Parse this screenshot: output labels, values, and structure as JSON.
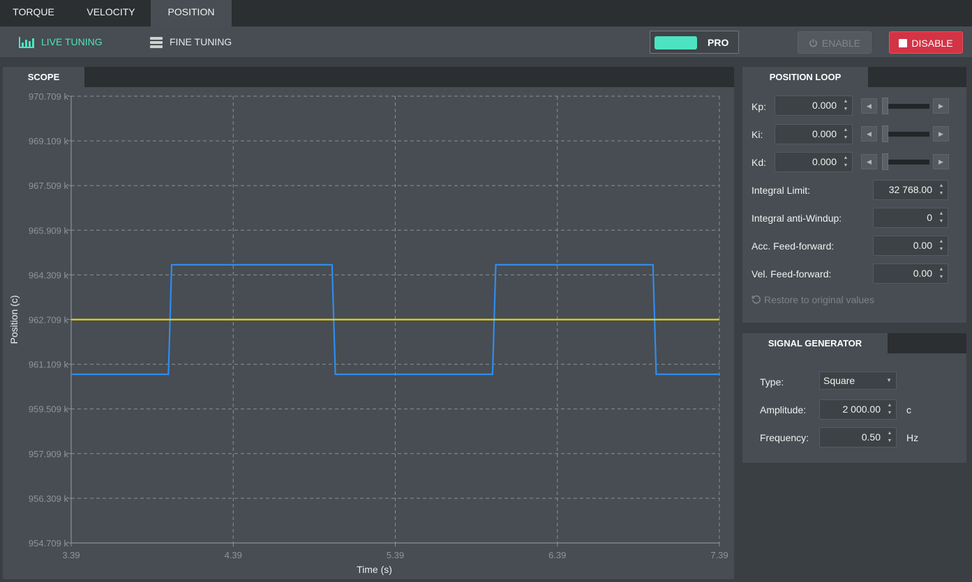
{
  "top_tabs": [
    {
      "label": "TORQUE",
      "active": false
    },
    {
      "label": "VELOCITY",
      "active": false
    },
    {
      "label": "POSITION",
      "active": true
    }
  ],
  "toolbar": {
    "live_tuning": "LIVE TUNING",
    "fine_tuning": "FINE TUNING",
    "pro_label": "PRO",
    "enable_label": "ENABLE",
    "disable_label": "DISABLE"
  },
  "scope": {
    "tab_label": "SCOPE"
  },
  "position_loop": {
    "tab_label": "POSITION LOOP",
    "gains": [
      {
        "label": "Kp:",
        "value": "0.000",
        "slider_fraction": 0
      },
      {
        "label": "Ki:",
        "value": "0.000",
        "slider_fraction": 0
      },
      {
        "label": "Kd:",
        "value": "0.000",
        "slider_fraction": 0
      }
    ],
    "params": [
      {
        "label": "Integral Limit:",
        "value": "32 768.00"
      },
      {
        "label": "Integral anti-Windup:",
        "value": "0"
      },
      {
        "label": "Acc. Feed-forward:",
        "value": "0.00"
      },
      {
        "label": "Vel. Feed-forward:",
        "value": "0.00"
      }
    ],
    "restore_label": "Restore to original values"
  },
  "signal_generator": {
    "tab_label": "SIGNAL GENERATOR",
    "type_label": "Type:",
    "type_value": "Square",
    "amplitude_label": "Amplitude:",
    "amplitude_value": "2 000.00",
    "amplitude_unit": "c",
    "frequency_label": "Frequency:",
    "frequency_value": "0.50",
    "frequency_unit": "Hz"
  },
  "colors": {
    "accent": "#4de3c2",
    "disable": "#d23445",
    "measured": "#2f8cf0",
    "reference": "#e5d31a"
  },
  "chart_data": {
    "type": "line",
    "xlabel": "Time (s)",
    "ylabel": "Position (c)",
    "x_ticks": [
      "3.39",
      "4.39",
      "5.39",
      "6.39",
      "7.39"
    ],
    "y_ticks": [
      "970.709 k",
      "969.109 k",
      "967.509 k",
      "965.909 k",
      "964.309 k",
      "962.709 k",
      "961.109 k",
      "959.509 k",
      "957.909 k",
      "956.309 k",
      "954.709 k"
    ],
    "xlim": [
      3.39,
      7.39
    ],
    "ylim": [
      954709,
      970709
    ],
    "grid": true,
    "series": [
      {
        "color": "#2f8cf0",
        "x": [
          3.39,
          3.99,
          4.01,
          5.0,
          5.02,
          5.99,
          6.01,
          6.98,
          7.0,
          7.39
        ],
        "y": [
          960750,
          960750,
          964670,
          964670,
          960750,
          960750,
          964670,
          964670,
          960750,
          960750
        ]
      },
      {
        "color": "#e5d31a",
        "x": [
          3.39,
          7.39
        ],
        "y": [
          962709,
          962709
        ]
      }
    ]
  }
}
